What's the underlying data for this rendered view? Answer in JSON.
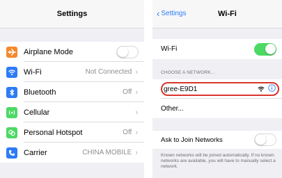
{
  "left_screen": {
    "title": "Settings",
    "rows": [
      {
        "label": "Airplane Mode",
        "icon": "airplane-icon",
        "icon_color": "#f5892a",
        "control": "toggle-off"
      },
      {
        "label": "Wi-Fi",
        "value": "Not Connected",
        "icon": "wifi-icon",
        "icon_color": "#2d7cf6"
      },
      {
        "label": "Bluetooth",
        "value": "Off",
        "icon": "bluetooth-icon",
        "icon_color": "#2d7cf6"
      },
      {
        "label": "Cellular",
        "value": "",
        "icon": "cellular-icon",
        "icon_color": "#4cd964"
      },
      {
        "label": "Personal Hotspot",
        "value": "Off",
        "icon": "hotspot-icon",
        "icon_color": "#4cd964"
      },
      {
        "label": "Carrier",
        "value": "CHINA MOBILE",
        "icon": "phone-icon",
        "icon_color": "#2d7cf6"
      }
    ]
  },
  "right_screen": {
    "back_label": "Settings",
    "title": "Wi-Fi",
    "wifi_row": {
      "label": "Wi-Fi",
      "toggle": "on"
    },
    "section_header": "CHOOSE A NETWORK...",
    "networks": [
      {
        "name": "gree-E9D1"
      }
    ],
    "other_label": "Other...",
    "ask_label": "Ask to Join Networks",
    "footer": "Known networks will be joined automatically. If no known networks are available, you will have to manually select a network."
  },
  "colors": {
    "accent": "#2d7cf6",
    "toggle_on": "#4cd964",
    "highlight_red": "#d9342b"
  }
}
